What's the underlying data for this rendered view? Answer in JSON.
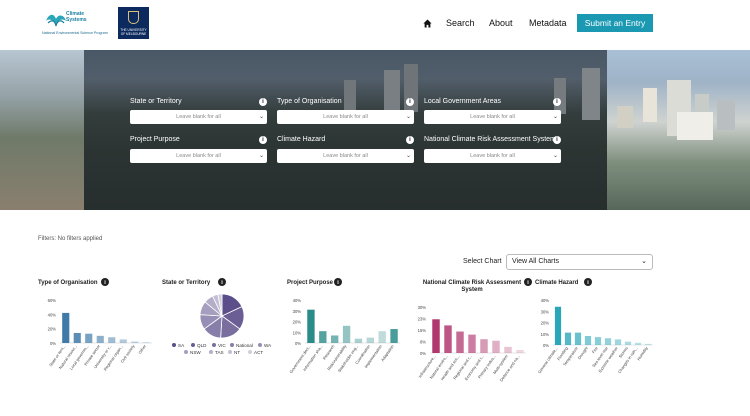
{
  "header": {
    "logo1_title": "Climate Systems",
    "logo1_subtitle": "National Environmental Science Program",
    "logo2_text": "THE UNIVERSITY OF MELBOURNE",
    "nav": [
      "Search",
      "About",
      "Metadata"
    ],
    "submit_label": "Submit an Entry"
  },
  "filters": [
    {
      "label": "State or Territory",
      "placeholder": "Leave blank for all"
    },
    {
      "label": "Type of Organisation",
      "placeholder": "Leave blank for all"
    },
    {
      "label": "Local Government Areas",
      "placeholder": "Leave blank for all"
    },
    {
      "label": "Project Purpose",
      "placeholder": "Leave blank for all"
    },
    {
      "label": "Climate Hazard",
      "placeholder": "Leave blank for all"
    },
    {
      "label": "National Climate Risk Assessment System",
      "placeholder": "Leave blank for all"
    }
  ],
  "status": "Filters: No filters applied",
  "select_chart": {
    "label": "Select Chart",
    "value": "View All Charts"
  },
  "info_glyph": "i",
  "colors": {
    "accent": "#1b99b3"
  },
  "chart_data": [
    {
      "type": "bar",
      "title": "Type of Organisation",
      "color": "#3f7aa8",
      "ylim": [
        0,
        60
      ],
      "yticks": [
        "0%",
        "20%",
        "40%",
        "60%"
      ],
      "categories": [
        "State or terri...",
        "Natural resour...",
        "Local governm...",
        "Private sector",
        "University or r...",
        "Regional organ...",
        "Civil society",
        "Other"
      ],
      "values": [
        42,
        14,
        13,
        10,
        8,
        5,
        2,
        1
      ],
      "alphas": [
        1,
        0.85,
        0.7,
        0.6,
        0.5,
        0.4,
        0.35,
        0.3
      ]
    },
    {
      "type": "pie",
      "title": "State or Territory",
      "color": "#5b4e89",
      "legend": [
        "SA",
        "QLD",
        "VIC",
        "National",
        "WA",
        "NSW",
        "TAS",
        "NT",
        "ACT"
      ],
      "values": [
        18,
        17,
        16,
        14,
        11,
        10,
        7,
        4,
        3
      ]
    },
    {
      "type": "bar",
      "title": "Project Purpose",
      "color": "#2a8c88",
      "ylim": [
        0,
        40
      ],
      "yticks": [
        "0%",
        "10%",
        "20%",
        "30%",
        "40%"
      ],
      "categories": [
        "Government deci...",
        "Information sha...",
        "Research",
        "Risk/vulnerability",
        "Stakeholder eng...",
        "Coordination",
        "Implementation",
        "Adaptation"
      ],
      "values": [
        31,
        11,
        7,
        16,
        4,
        5,
        11,
        13
      ],
      "alphas": [
        1,
        0.8,
        0.65,
        0.5,
        0.4,
        0.35,
        0.3,
        0.85
      ]
    },
    {
      "type": "bar",
      "title": "National Climate Risk Assessment System",
      "color": "#b1386e",
      "ylim": [
        0,
        30
      ],
      "yticks": [
        "0%",
        "8%",
        "15%",
        "23%",
        "30%"
      ],
      "categories": [
        "Infrastructure...",
        "Natural enviro...",
        "Health and soc...",
        "Regional and r...",
        "Economy and t...",
        "Primary indus...",
        "Multi-system",
        "Defence and na..."
      ],
      "values": [
        22,
        18,
        14,
        12,
        9,
        8,
        4,
        2
      ],
      "alphas": [
        1,
        0.85,
        0.75,
        0.65,
        0.5,
        0.4,
        0.3,
        0.2
      ]
    },
    {
      "type": "bar",
      "title": "Climate Hazard",
      "color": "#2aa6b8",
      "ylim": [
        0,
        40
      ],
      "yticks": [
        "0%",
        "10%",
        "20%",
        "30%",
        "40%"
      ],
      "categories": [
        "General climate...",
        "Flooding",
        "Temperature",
        "Drought",
        "Fire",
        "Sea level rise",
        "Extreme weather",
        "Storms",
        "Changes in rain...",
        "Humidity"
      ],
      "values": [
        34,
        11,
        11,
        8,
        7,
        6,
        5,
        3,
        2,
        1
      ],
      "alphas": [
        1,
        0.8,
        0.7,
        0.6,
        0.55,
        0.5,
        0.45,
        0.4,
        0.35,
        0.3
      ]
    }
  ]
}
